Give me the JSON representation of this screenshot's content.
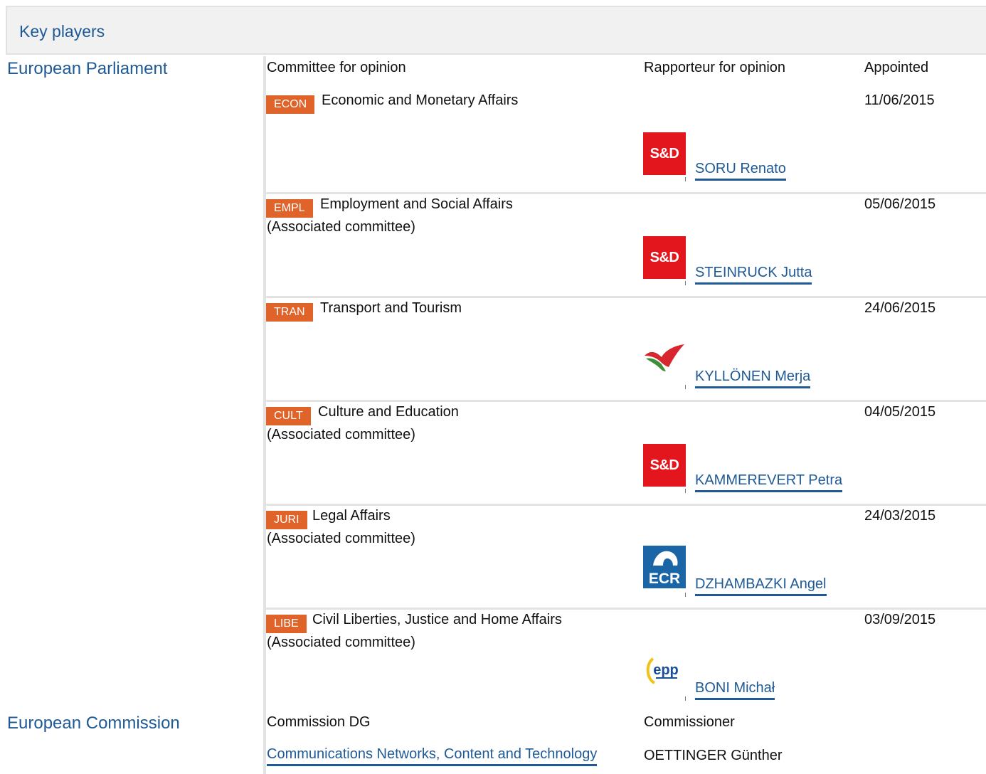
{
  "header": {
    "title": "Key players"
  },
  "parliament": {
    "label": "European Parliament",
    "headers": {
      "committee": "Committee for opinion",
      "rapporteur": "Rapporteur for opinion",
      "appointed": "Appointed"
    },
    "rows": [
      {
        "code": "ECON",
        "name": "Economic and Monetary Affairs",
        "associated": "",
        "date": "11/06/2015",
        "rapporteur": "SORU Renato",
        "group_logo": "sd-logo",
        "group_text": "S&D"
      },
      {
        "code": "EMPL",
        "name": "Employment and Social Affairs",
        "associated": "(Associated committee)",
        "date": "05/06/2015",
        "rapporteur": "STEINRUCK Jutta",
        "group_logo": "sd-logo",
        "group_text": "S&D"
      },
      {
        "code": "TRAN",
        "name": "Transport and Tourism",
        "associated": "",
        "date": "24/06/2015",
        "rapporteur": "KYLLÖNEN Merja",
        "group_logo": "gue-ngl-logo",
        "group_text": ""
      },
      {
        "code": "CULT",
        "name": "Culture and Education",
        "associated": "(Associated committee)",
        "date": "04/05/2015",
        "rapporteur": "KAMMEREVERT Petra",
        "group_logo": "sd-logo",
        "group_text": "S&D"
      },
      {
        "code": "JURI",
        "name": "Legal Affairs",
        "associated": "(Associated committee)",
        "date": "24/03/2015",
        "rapporteur": "DZHAMBAZKI Angel",
        "group_logo": "ecr-logo",
        "group_text": "ECR"
      },
      {
        "code": "LIBE",
        "name": "Civil Liberties, Justice and Home Affairs",
        "associated": "(Associated committee)",
        "date": "03/09/2015",
        "rapporteur": "BONI Michał",
        "group_logo": "epp-logo",
        "group_text": "epp"
      }
    ]
  },
  "commission": {
    "label": "European Commission",
    "headers": {
      "dg": "Commission DG",
      "commissioner": "Commissioner"
    },
    "dg": "Communications Networks, Content and Technology",
    "commissioner": "OETTINGER Günther"
  },
  "colors": {
    "badge": "#e0632a",
    "link": "#1f5a96",
    "sd_red": "#e3161e",
    "ecr_blue": "#1a65a6"
  }
}
